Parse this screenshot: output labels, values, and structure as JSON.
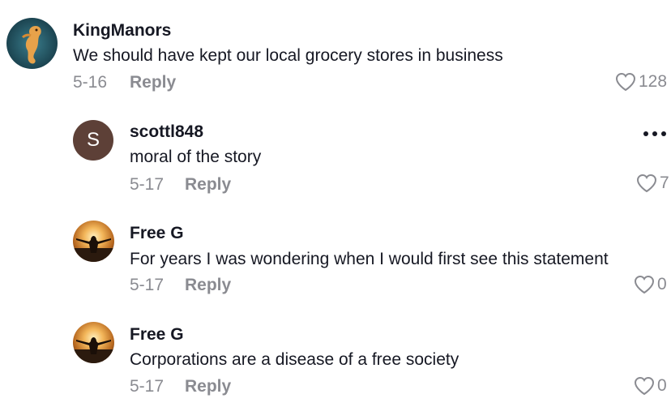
{
  "comments": [
    {
      "username": "KingManors",
      "text": "We should have kept our local grocery stores in business",
      "date": "5-16",
      "reply_label": "Reply",
      "likes": "128",
      "avatar_icon": "seahorse-avatar"
    },
    {
      "username": "scottl848",
      "text": "moral of the story",
      "date": "5-17",
      "reply_label": "Reply",
      "likes": "7",
      "avatar_initial": "S",
      "avatar_color": "#5d4037"
    },
    {
      "username": "Free G",
      "text": "For years I was wondering when I would first see this statement",
      "date": "5-17",
      "reply_label": "Reply",
      "likes": "0",
      "avatar_icon": "sunset-silhouette-avatar"
    },
    {
      "username": "Free G",
      "text": "Corporations are a disease of a free society",
      "date": "5-17",
      "reply_label": "Reply",
      "likes": "0",
      "avatar_icon": "sunset-silhouette-avatar"
    }
  ],
  "colors": {
    "text_primary": "#161823",
    "text_secondary": "#8a8b91",
    "background": "#ffffff"
  }
}
